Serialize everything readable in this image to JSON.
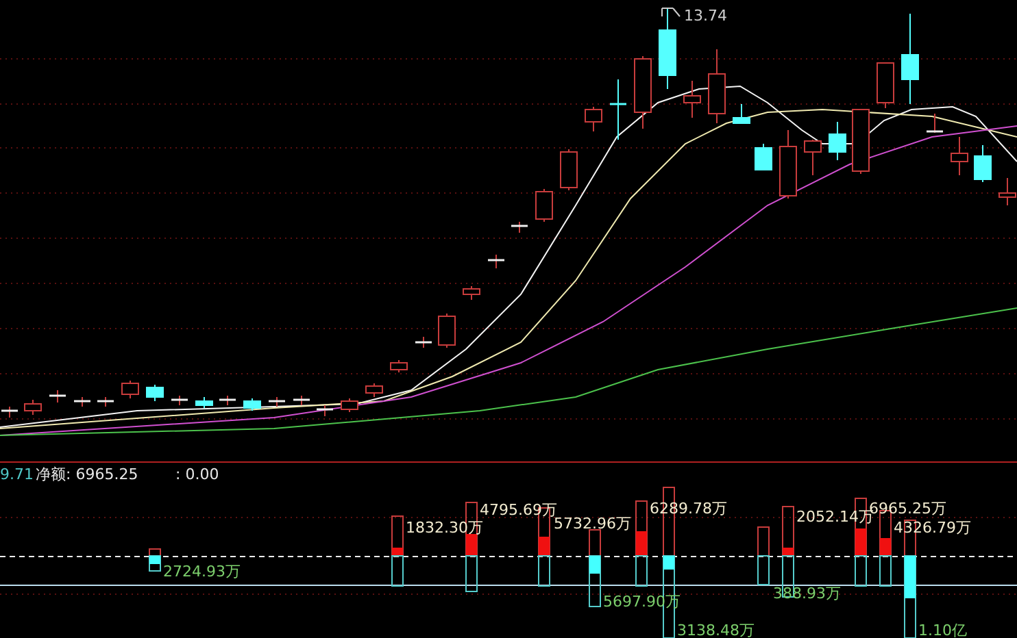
{
  "price_chart": {
    "high_label": "13.74"
  },
  "indicator_header": [
    {
      "text": "9.71",
      "kind": "value"
    },
    {
      "text": "净额: 6965.25",
      "kind": "label"
    },
    {
      "text": ": 0.00",
      "kind": "label"
    }
  ],
  "flow_labels": [
    {
      "text": "2724.93万",
      "kind": "outflow"
    },
    {
      "text": "1832.30万",
      "kind": "inflow"
    },
    {
      "text": "4795.69万",
      "kind": "inflow"
    },
    {
      "text": "5732.96万",
      "kind": "inflow"
    },
    {
      "text": "6289.78万",
      "kind": "inflow"
    },
    {
      "text": "5697.90万",
      "kind": "outflow"
    },
    {
      "text": "3138.48万",
      "kind": "outflow"
    },
    {
      "text": "2052.14万",
      "kind": "inflow"
    },
    {
      "text": "388.93万",
      "kind": "outflow"
    },
    {
      "text": "6965.25万",
      "kind": "inflow"
    },
    {
      "text": "4326.79万",
      "kind": "inflow"
    },
    {
      "text": "1.10亿",
      "kind": "outflow"
    }
  ]
}
